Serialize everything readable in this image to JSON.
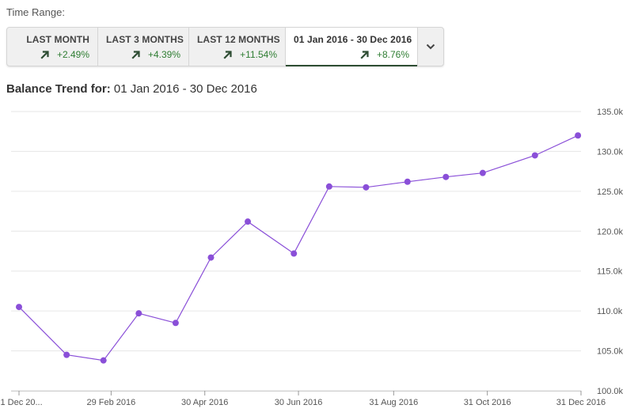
{
  "time_range": {
    "label": "Time Range:",
    "tabs": [
      {
        "label": "LAST MONTH",
        "change": "+2.49%",
        "active": false
      },
      {
        "label": "LAST 3 MONTHS",
        "change": "+4.39%",
        "active": false
      },
      {
        "label": "LAST 12 MONTHS",
        "change": "+11.54%",
        "active": false
      },
      {
        "label": "01 Jan 2016 - 30 Dec 2016",
        "change": "+8.76%",
        "active": true
      }
    ],
    "dropdown_icon": "chevron-down-icon",
    "change_icon": "arrow-up-right-icon"
  },
  "trend": {
    "title_prefix": "Balance Trend for:",
    "title_range": "01 Jan 2016 - 30 Dec 2016"
  },
  "colors": {
    "line": "#8a4fd8",
    "positive": "#2e7d32",
    "grid": "#e6e6e6"
  },
  "chart_data": {
    "type": "line",
    "series": [
      {
        "x": [
          "2015-12-31",
          "2016-01-31",
          "2016-02-29",
          "2016-03-31",
          "2016-04-30",
          "2016-05-31",
          "2016-06-30",
          "2016-07-31",
          "2016-08-31",
          "2016-09-30",
          "2016-10-31",
          "2016-11-30",
          "2016-12-31"
        ],
        "values": [
          110.5,
          104.5,
          103.8,
          109.7,
          108.5,
          116.7,
          121.2,
          117.2,
          125.6,
          125.5,
          126.2,
          126.8,
          127.3
        ],
        "extra": []
      }
    ],
    "x": [
      "2015-12-31",
      "2016-01-31",
      "2016-02-29",
      "2016-03-31",
      "2016-04-30",
      "2016-05-31",
      "2016-06-30",
      "2016-07-31",
      "2016-08-15",
      "2016-09-15",
      "2016-10-15",
      "2016-11-15",
      "2016-12-01",
      "2016-12-15",
      "2016-12-31"
    ],
    "points": [
      {
        "x": "2015-12-31",
        "y": 110.5
      },
      {
        "x": "2016-01-31",
        "y": 104.5
      },
      {
        "x": "2016-02-24",
        "y": 103.8
      },
      {
        "x": "2016-03-18",
        "y": 109.7
      },
      {
        "x": "2016-04-11",
        "y": 108.5
      },
      {
        "x": "2016-05-04",
        "y": 116.7
      },
      {
        "x": "2016-05-28",
        "y": 121.2
      },
      {
        "x": "2016-06-27",
        "y": 117.2
      },
      {
        "x": "2016-07-20",
        "y": 125.6
      },
      {
        "x": "2016-08-13",
        "y": 125.5
      },
      {
        "x": "2016-09-09",
        "y": 126.2
      },
      {
        "x": "2016-10-04",
        "y": 126.8
      },
      {
        "x": "2016-10-28",
        "y": 127.3
      },
      {
        "x": "2016-12-01",
        "y": 129.5
      },
      {
        "x": "2016-12-29",
        "y": 132.0
      }
    ],
    "x_range": [
      "2015-12-31",
      "2016-12-31"
    ],
    "xticks": [
      {
        "date": "2015-12-31",
        "label": "31 Dec 20..."
      },
      {
        "date": "2016-02-29",
        "label": "29 Feb 2016"
      },
      {
        "date": "2016-04-30",
        "label": "30 Apr 2016"
      },
      {
        "date": "2016-06-30",
        "label": "30 Jun 2016"
      },
      {
        "date": "2016-08-31",
        "label": "31 Aug 2016"
      },
      {
        "date": "2016-10-31",
        "label": "31 Oct 2016"
      },
      {
        "date": "2016-12-31",
        "label": "31 Dec 2016"
      }
    ],
    "ylim": [
      100,
      135
    ],
    "yticks": [
      {
        "value": 100,
        "label": "100.0k"
      },
      {
        "value": 105,
        "label": "105.0k"
      },
      {
        "value": 110,
        "label": "110.0k"
      },
      {
        "value": 115,
        "label": "115.0k"
      },
      {
        "value": 120,
        "label": "120.0k"
      },
      {
        "value": 125,
        "label": "125.0k"
      },
      {
        "value": 130,
        "label": "130.0k"
      },
      {
        "value": 135,
        "label": "135.0k"
      }
    ],
    "y_axis_side": "right",
    "grid": true,
    "legend": "none"
  }
}
